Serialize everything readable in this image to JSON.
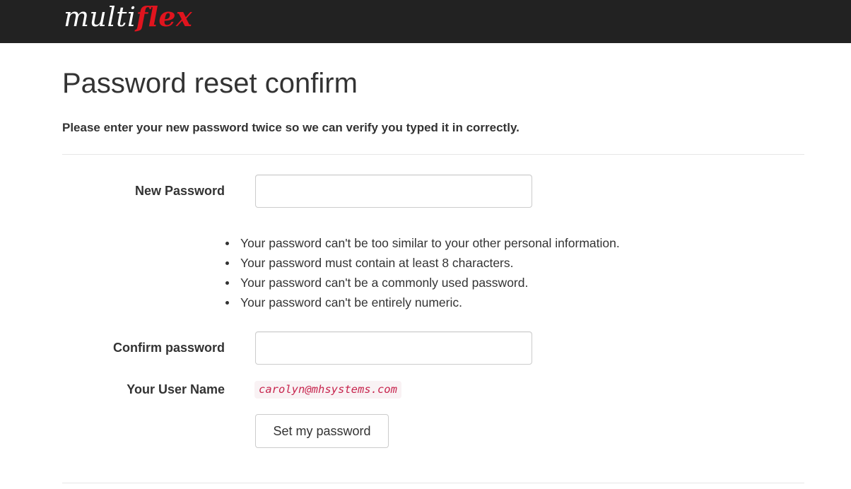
{
  "header": {
    "brand_part1": "multi",
    "brand_part2": "flex",
    "brand_accent_color": "#e0141e",
    "background_color": "#222222"
  },
  "page": {
    "title": "Password reset confirm",
    "intro": "Please enter your new password twice so we can verify you typed it in correctly."
  },
  "form": {
    "new_password": {
      "label": "New Password",
      "value": "",
      "placeholder": ""
    },
    "help_items": [
      "Your password can't be too similar to your other personal information.",
      "Your password must contain at least 8 characters.",
      "Your password can't be a commonly used password.",
      "Your password can't be entirely numeric."
    ],
    "confirm_password": {
      "label": "Confirm password",
      "value": "",
      "placeholder": ""
    },
    "username": {
      "label": "Your User Name",
      "value": "carolyn@mhsystems.com",
      "value_color": "#c7254e"
    },
    "submit_label": "Set my password"
  }
}
